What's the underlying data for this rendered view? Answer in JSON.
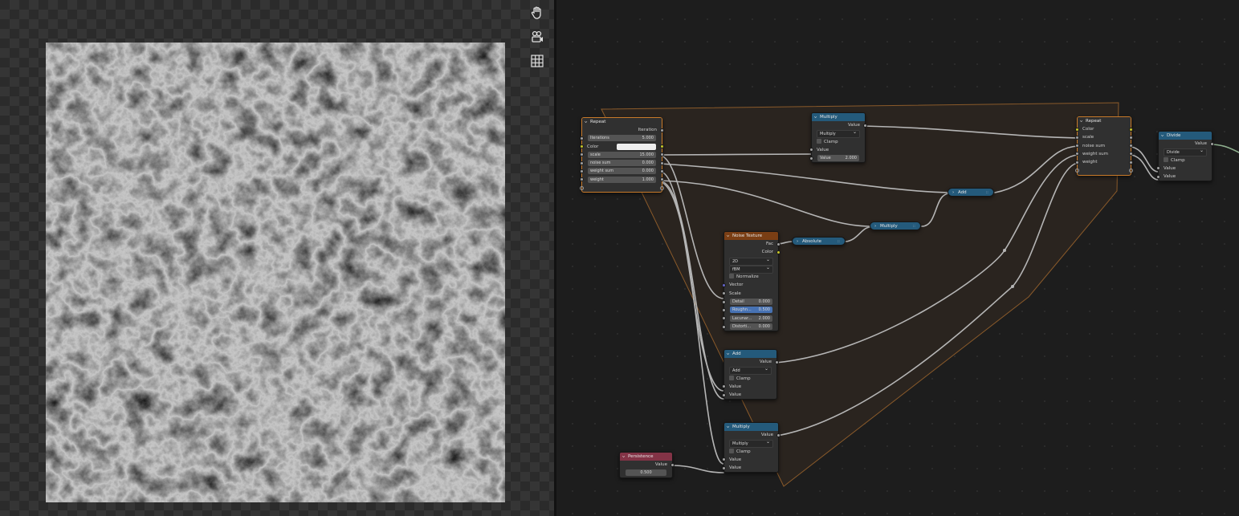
{
  "viewport": {
    "tools": [
      {
        "icon": "hand-pan-icon"
      },
      {
        "icon": "camera-view-icon"
      },
      {
        "icon": "grid-icon"
      }
    ]
  },
  "nodes": {
    "repeat_input": {
      "title": "Repeat",
      "output_label": "Iteration",
      "iterations_label": "Iterations",
      "iterations_value": "5.000",
      "color_label": "Color",
      "scale_label": "scale",
      "scale_value": "15.000",
      "noise_sum_label": "noise sum",
      "noise_sum_value": "0.000",
      "weight_sum_label": "weight sum",
      "weight_sum_value": "0.000",
      "weight_label": "weight",
      "weight_value": "1.000"
    },
    "multiply_top": {
      "title": "Multiply",
      "output_label": "Value",
      "operation": "Multiply",
      "clamp_label": "Clamp",
      "input_label": "Value",
      "value_label": "Value",
      "value_value": "2.000"
    },
    "repeat_output": {
      "title": "Repeat",
      "items": [
        "Color",
        "scale",
        "noise sum",
        "weight sum",
        "weight"
      ]
    },
    "divide": {
      "title": "Divide",
      "output_label": "Value",
      "operation": "Divide",
      "clamp_label": "Clamp",
      "input1_label": "Value",
      "input2_label": "Value"
    },
    "add_mini": {
      "title": "Add"
    },
    "multiply_mini": {
      "title": "Multiply"
    },
    "absolute_mini": {
      "title": "Absolute"
    },
    "noise_texture": {
      "title": "Noise Texture",
      "fac_label": "Fac",
      "color_label": "Color",
      "dimensions": "2D",
      "type": "fBM",
      "normalize_label": "Normalize",
      "vector_label": "Vector",
      "scale_label": "Scale",
      "detail_label": "Detail",
      "detail_value": "0.000",
      "roughness_label": "Roughn...",
      "roughness_value": "0.500",
      "lacunarity_label": "Lacunar...",
      "lacunarity_value": "2.000",
      "distortion_label": "Distorti...",
      "distortion_value": "0.000"
    },
    "add_math": {
      "title": "Add",
      "output_label": "Value",
      "operation": "Add",
      "clamp_label": "Clamp",
      "input1_label": "Value",
      "input2_label": "Value"
    },
    "multiply_bottom": {
      "title": "Multiply",
      "output_label": "Value",
      "operation": "Multiply",
      "clamp_label": "Clamp",
      "input1_label": "Value",
      "input2_label": "Value"
    },
    "persistence": {
      "title": "Persistence",
      "output_label": "Value",
      "value": "0.500"
    }
  },
  "colors": {
    "math_header": "#245a7b",
    "texture_header": "#7a3e14",
    "input_header": "#833346",
    "zone_border": "#8a5a2a",
    "zone_fill": "#2a241f",
    "wire": "#b5b5b5"
  }
}
